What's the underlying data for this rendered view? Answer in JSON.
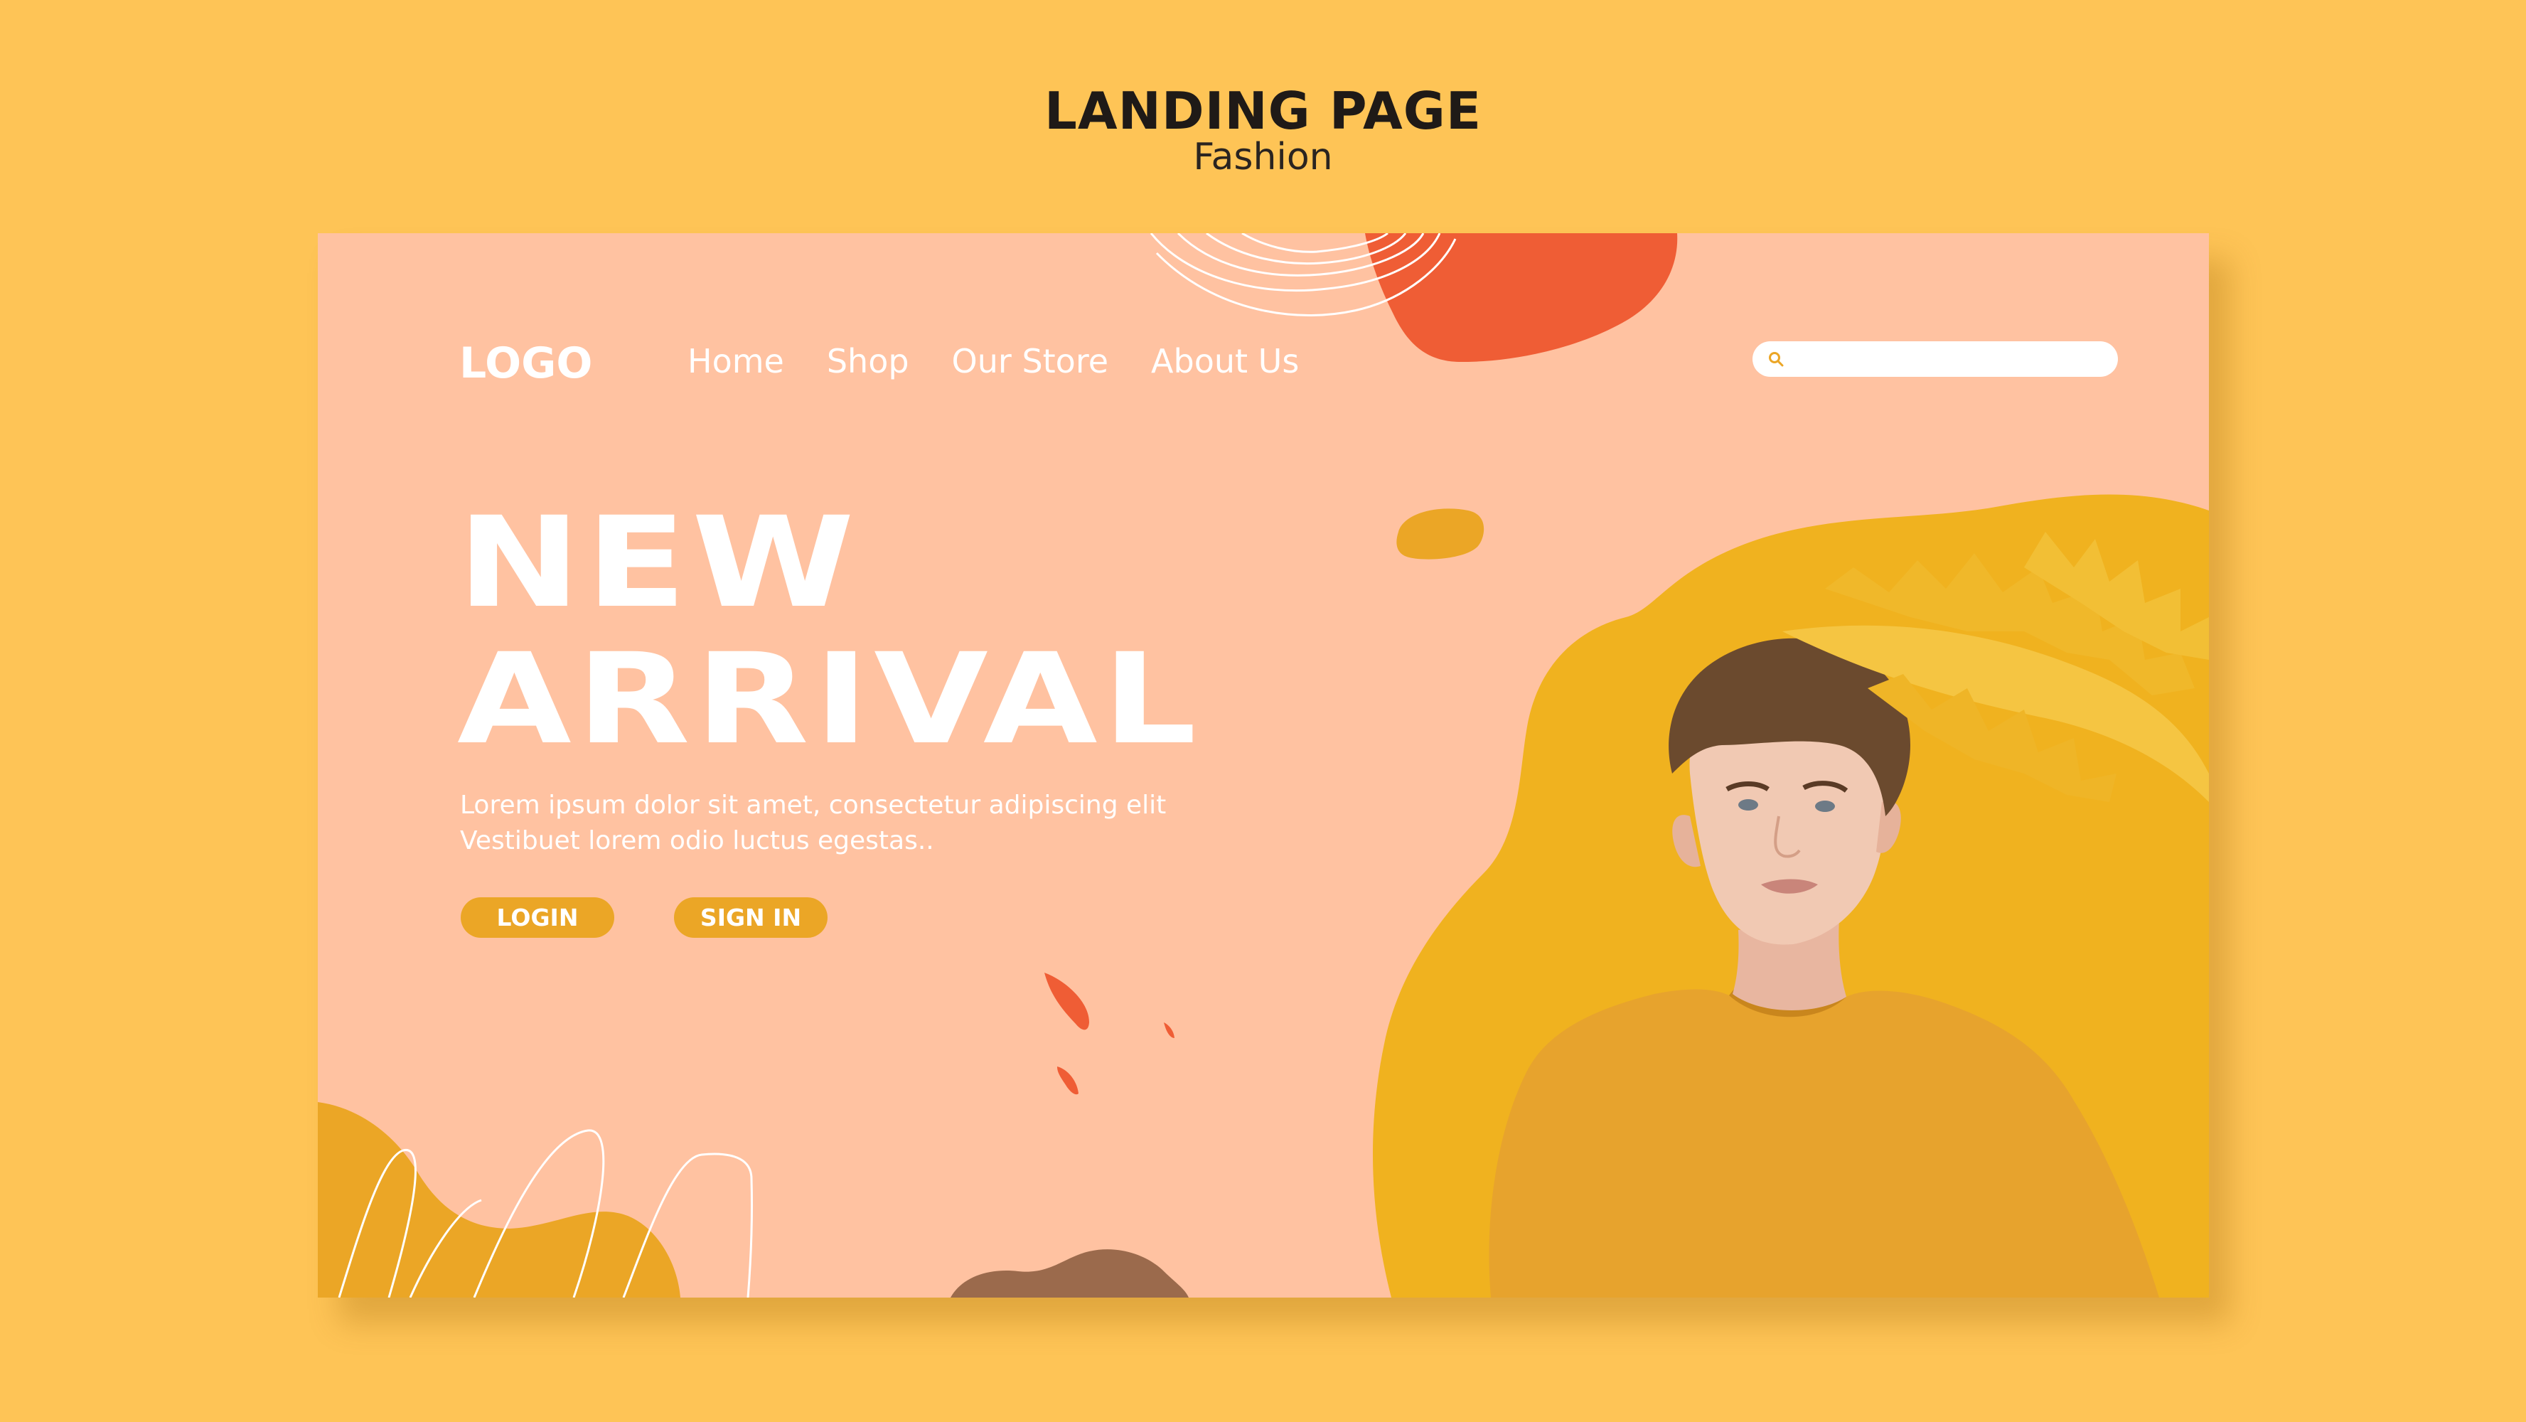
{
  "page": {
    "title": "LANDING PAGE",
    "subtitle": "Fashion"
  },
  "header": {
    "logo": "LOGO",
    "nav": [
      {
        "label": "Home"
      },
      {
        "label": "Shop"
      },
      {
        "label": "Our Store"
      },
      {
        "label": "About Us"
      }
    ],
    "search": {
      "placeholder": "",
      "value": "",
      "icon": "search-icon"
    }
  },
  "hero": {
    "title_line1": "NEW",
    "title_line2": "ARRIVAL",
    "body_line1": "Lorem ipsum dolor sit amet, consectetur adipiscing elit",
    "body_line2": "Vestibuet lorem odio luctus egestas..",
    "login_label": "LOGIN",
    "signin_label": "SIGN IN"
  },
  "colors": {
    "background": "#fec456",
    "card": "#ffc2a1",
    "accent_orange": "#ef5d35",
    "accent_yellow": "#eba626",
    "accent_brown": "#9b6a4c",
    "sweater": "#e7a32d"
  }
}
